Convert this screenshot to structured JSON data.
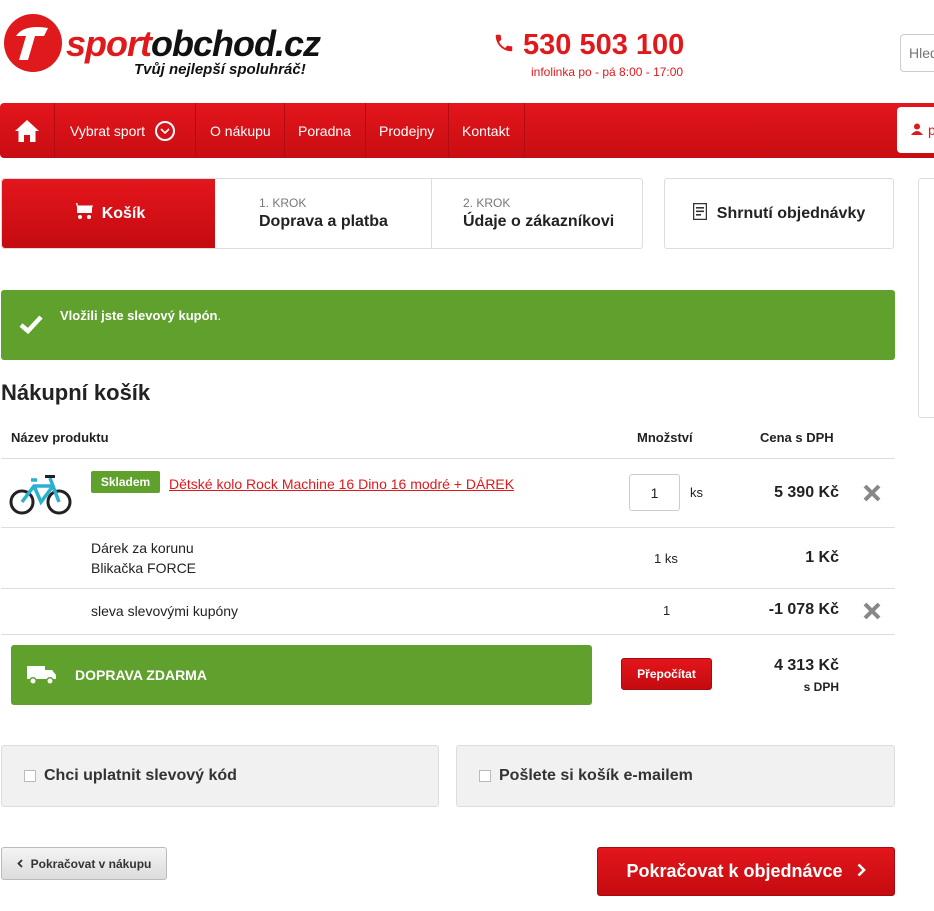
{
  "header": {
    "logo_text_red": "sport",
    "logo_text_black": "obchod.cz",
    "slogan": "Tvůj nejlepší spoluhráč!",
    "phone": "530 503 100",
    "phone_sub": "infolinka po - pá 8:00 - 17:00",
    "search_placeholder": "Hled"
  },
  "nav": {
    "items": [
      "Vybrat sport",
      "O nákupu",
      "Poradna",
      "Prodejny",
      "Kontakt"
    ],
    "user_label": "p"
  },
  "steps": {
    "active": "Košík",
    "step1_num": "1. KROK",
    "step1_label": "Doprava a platba",
    "step2_num": "2. KROK",
    "step2_label": "Údaje o zákazníkovi",
    "summary": "Shrnutí objednávky"
  },
  "alert": {
    "text": "Vložili jste slevový kupón",
    "suffix": "."
  },
  "cart": {
    "title": "Nákupní košík",
    "headers": {
      "product": "Název produktu",
      "qty": "Množství",
      "price": "Cena s DPH"
    },
    "items": [
      {
        "badge": "Skladem",
        "name": "Dětské kolo Rock Machine 16 Dino 16 modré + DÁREK",
        "qty": "1",
        "unit": "ks",
        "price": "5 390 Kč"
      }
    ],
    "gift": {
      "line1": "Dárek za korunu",
      "line2": "Blikačka FORCE",
      "qty": "1 ks",
      "price": "1 Kč"
    },
    "discount": {
      "name": "sleva slevovými kupóny",
      "qty": "1",
      "price": "-1 078 Kč"
    },
    "shipping_label": "DOPRAVA ZDARMA",
    "recalc_label": "Přepočítat",
    "total": "4 313 Kč",
    "total_sub": "s DPH"
  },
  "options": {
    "coupon": "Chci uplatnit slevový kód",
    "email": "Pošlete si košík e-mailem"
  },
  "buttons": {
    "back": "Pokračovat v nákupu",
    "next": "Pokračovat k objednávce"
  },
  "colors": {
    "brand_red": "#e0191d",
    "success_green": "#5fa12c"
  }
}
